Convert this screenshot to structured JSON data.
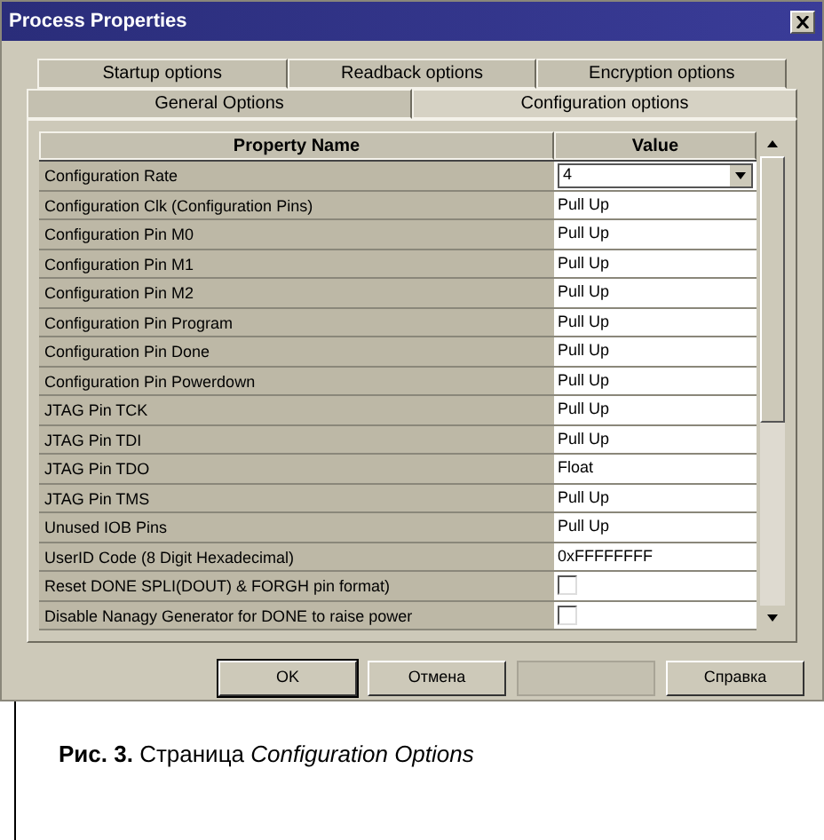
{
  "window": {
    "title": "Process Properties"
  },
  "tab_rows": [
    [
      {
        "label": "Startup options",
        "selected": false
      },
      {
        "label": "Readback options",
        "selected": false
      },
      {
        "label": "Encryption options",
        "selected": false
      }
    ],
    [
      {
        "label": "General Options",
        "selected": false
      },
      {
        "label": "Configuration options",
        "selected": true
      }
    ]
  ],
  "table": {
    "columns": [
      "Property Name",
      "Value"
    ],
    "rows": [
      {
        "name": "Configuration Rate",
        "kind": "dropdown",
        "value": "4"
      },
      {
        "name": "Configuration Clk (Configuration Pins)",
        "kind": "text",
        "value": "Pull Up"
      },
      {
        "name": "Configuration Pin M0",
        "kind": "text",
        "value": "Pull Up"
      },
      {
        "name": "Configuration Pin M1",
        "kind": "text",
        "value": "Pull Up"
      },
      {
        "name": "Configuration Pin M2",
        "kind": "text",
        "value": "Pull Up"
      },
      {
        "name": "Configuration Pin Program",
        "kind": "text",
        "value": "Pull Up"
      },
      {
        "name": "Configuration Pin Done",
        "kind": "text",
        "value": "Pull Up"
      },
      {
        "name": "Configuration Pin Powerdown",
        "kind": "text",
        "value": "Pull Up"
      },
      {
        "name": "JTAG Pin TCK",
        "kind": "text",
        "value": "Pull Up"
      },
      {
        "name": "JTAG Pin TDI",
        "kind": "text",
        "value": "Pull Up"
      },
      {
        "name": "JTAG Pin TDO",
        "kind": "text",
        "value": "Float"
      },
      {
        "name": "JTAG Pin TMS",
        "kind": "text",
        "value": "Pull Up"
      },
      {
        "name": "Unused IOB Pins",
        "kind": "text",
        "value": "Pull Up"
      },
      {
        "name": "UserID Code (8 Digit Hexadecimal)",
        "kind": "text",
        "value": "0xFFFFFFFF"
      },
      {
        "name": "Reset DONE SPLI(DOUT) & FORGH pin format)",
        "kind": "checkbox",
        "checked": false
      },
      {
        "name": "Disable Nanagy Generator for DONE to raise power",
        "kind": "checkbox",
        "checked": false
      }
    ]
  },
  "buttons": [
    {
      "label": "OK",
      "disabled": false
    },
    {
      "label": "Отмена",
      "disabled": false
    },
    {
      "disabled": true
    },
    {
      "label": "Справка",
      "disabled": false
    }
  ],
  "caption": "**Рис. 3.** Страница *Configuration Options*"
}
